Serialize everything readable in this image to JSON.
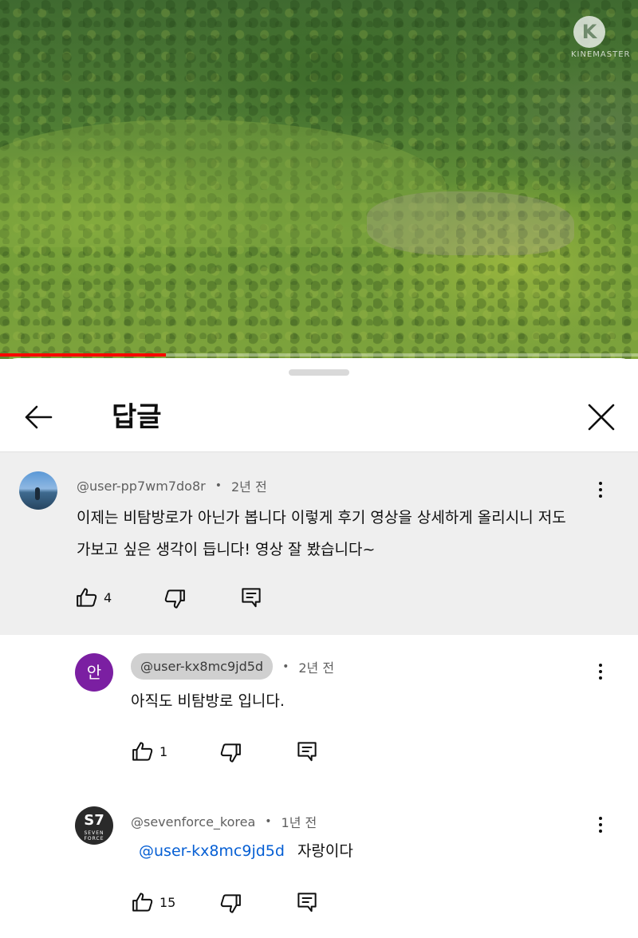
{
  "video": {
    "watermark_label": "KINEMASTER",
    "watermark_icon": "kinemaster-logo-icon",
    "progress_fraction": 0.26,
    "accent_color": "#ff0000"
  },
  "header": {
    "title": "답글",
    "back_icon": "arrow-left-icon",
    "close_icon": "close-icon"
  },
  "comments": [
    {
      "author": "@user-pp7wm7do8r",
      "time": "2년 전",
      "lines": [
        "이제는 비탐방로가 아닌가 봅니다 이렇게 후기 영상을 상세하게 올리시니 저도",
        "가보고 싶은 생각이 듭니다! 영상 잘 봤습니다~"
      ],
      "likes": "4"
    },
    {
      "avatar_letter": "안",
      "author": "@user-kx8mc9jd5d",
      "time": "2년 전",
      "text": "아직도 비탐방로 입니다.",
      "likes": "1"
    },
    {
      "avatar_logo": "S7",
      "avatar_logo_sub": "SEVEN FORCE",
      "author": "@sevenforce_korea",
      "time": "1년 전",
      "mention": "@user-kx8mc9jd5d",
      "text": "자랑이다",
      "likes": "15"
    }
  ]
}
